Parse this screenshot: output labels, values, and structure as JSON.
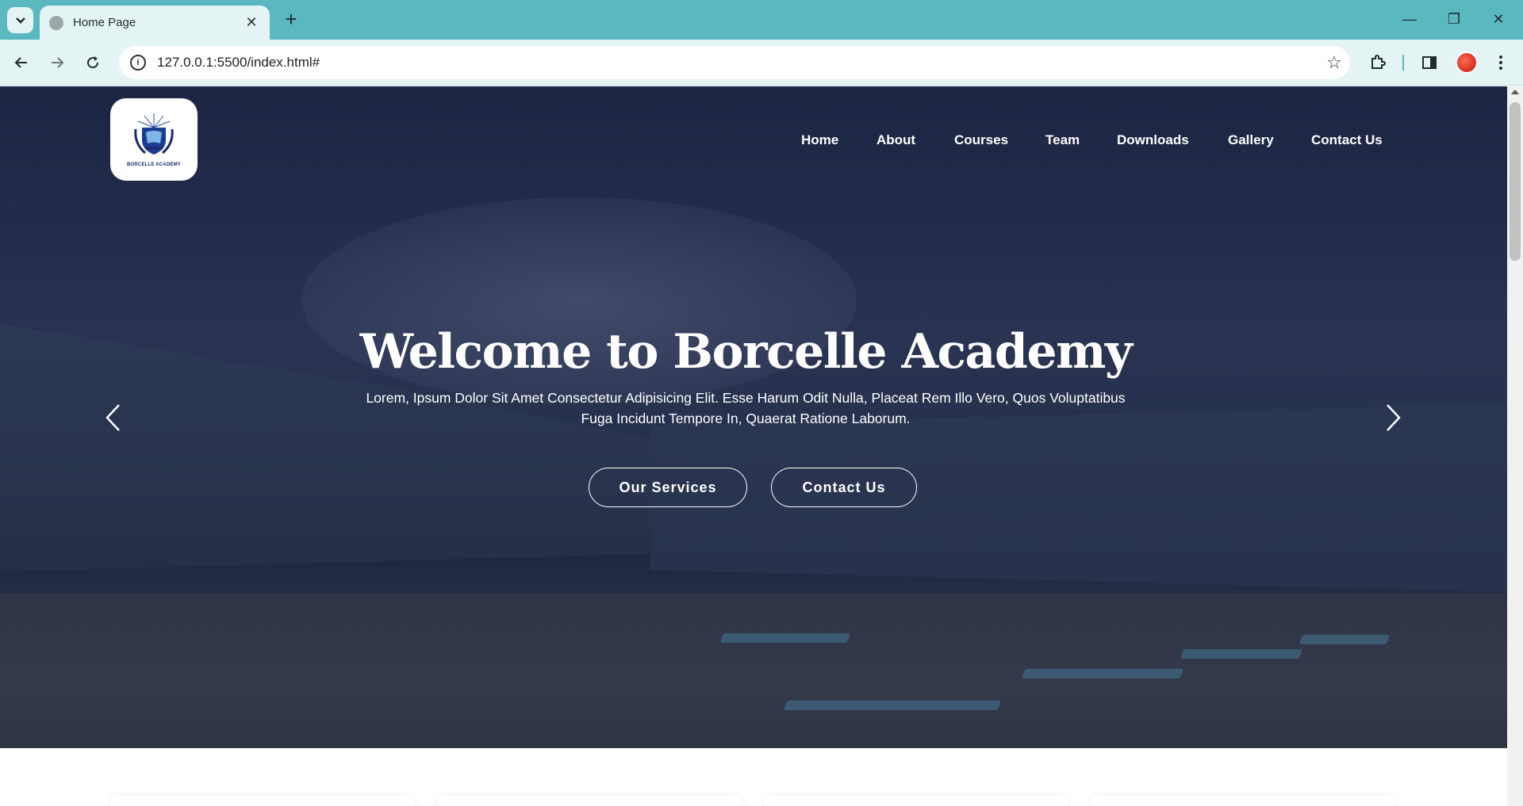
{
  "browser": {
    "tab_title": "Home Page",
    "url": "127.0.0.1:5500/index.html#"
  },
  "site": {
    "logo_text": "BORCELLE ACADEMY",
    "nav": [
      "Home",
      "About",
      "Courses",
      "Team",
      "Downloads",
      "Gallery",
      "Contact Us"
    ]
  },
  "hero": {
    "title": "Welcome to Borcelle Academy",
    "subtitle": "Lorem, Ipsum Dolor Sit Amet Consectetur Adipisicing Elit. Esse Harum Odit Nulla, Placeat Rem Illo Vero, Quos Voluptatibus Fuga Incidunt Tempore In, Quaerat Ratione Laborum.",
    "btn_services": "Our Services",
    "btn_contact": "Contact Us"
  },
  "colors": {
    "tabstrip": "#5ab8c1",
    "toolbar": "#e4f3f4",
    "hero_overlay": "#1c2542"
  }
}
